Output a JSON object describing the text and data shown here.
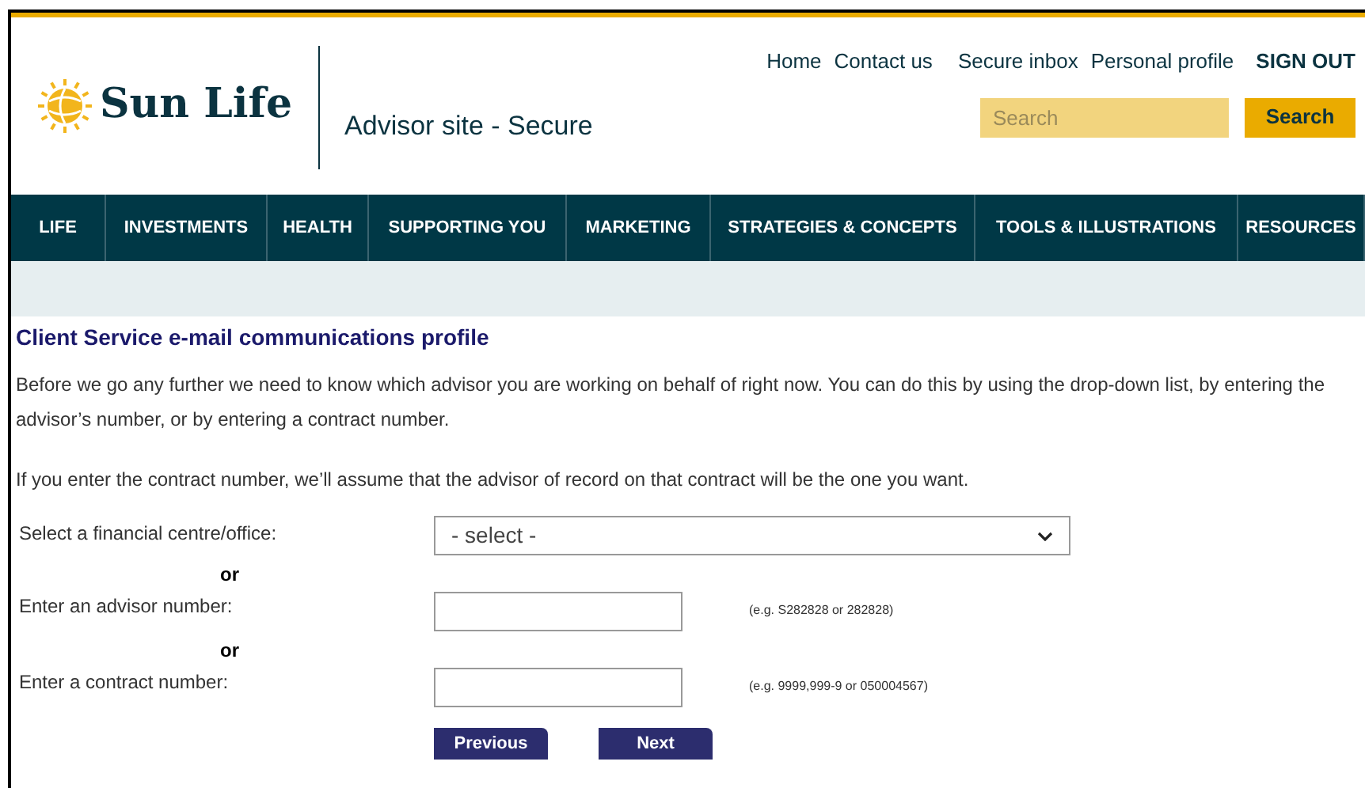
{
  "header": {
    "logo": "Sun Life",
    "site_title": "Advisor site - Secure",
    "links": [
      "Home",
      "Contact us",
      "Secure inbox",
      "Personal profile"
    ],
    "sign_out": "SIGN OUT",
    "search": {
      "placeholder": "Search",
      "button": "Search"
    }
  },
  "nav": [
    "LIFE",
    "INVESTMENTS",
    "HEALTH",
    "SUPPORTING YOU",
    "MARKETING",
    "STRATEGIES & CONCEPTS",
    "TOOLS & ILLUSTRATIONS",
    "RESOURCES"
  ],
  "content": {
    "title": "Client Service e-mail communications profile",
    "paragraphs": [
      "Before we go any further we need to know which advisor you are working on behalf of right now. You can do this by using the drop-down list, by entering the advisor’s number, or by entering a contract number.",
      "If you enter the contract number, we’ll assume that the advisor of record on that contract will be the one you want."
    ],
    "form": [
      {
        "kind": "select",
        "label": "Select a financial centre/office:",
        "value": "- select -"
      },
      {
        "kind": "separator",
        "label": "or"
      },
      {
        "kind": "input",
        "label": "Enter an advisor number:",
        "hint": "(e.g. S282828 or 282828)"
      },
      {
        "kind": "separator",
        "label": "or"
      },
      {
        "kind": "input",
        "label": "Enter a contract number:",
        "hint": "(e.g. 9999,999-9 or 050004567)"
      }
    ],
    "buttons": [
      "Previous",
      "Next"
    ]
  }
}
